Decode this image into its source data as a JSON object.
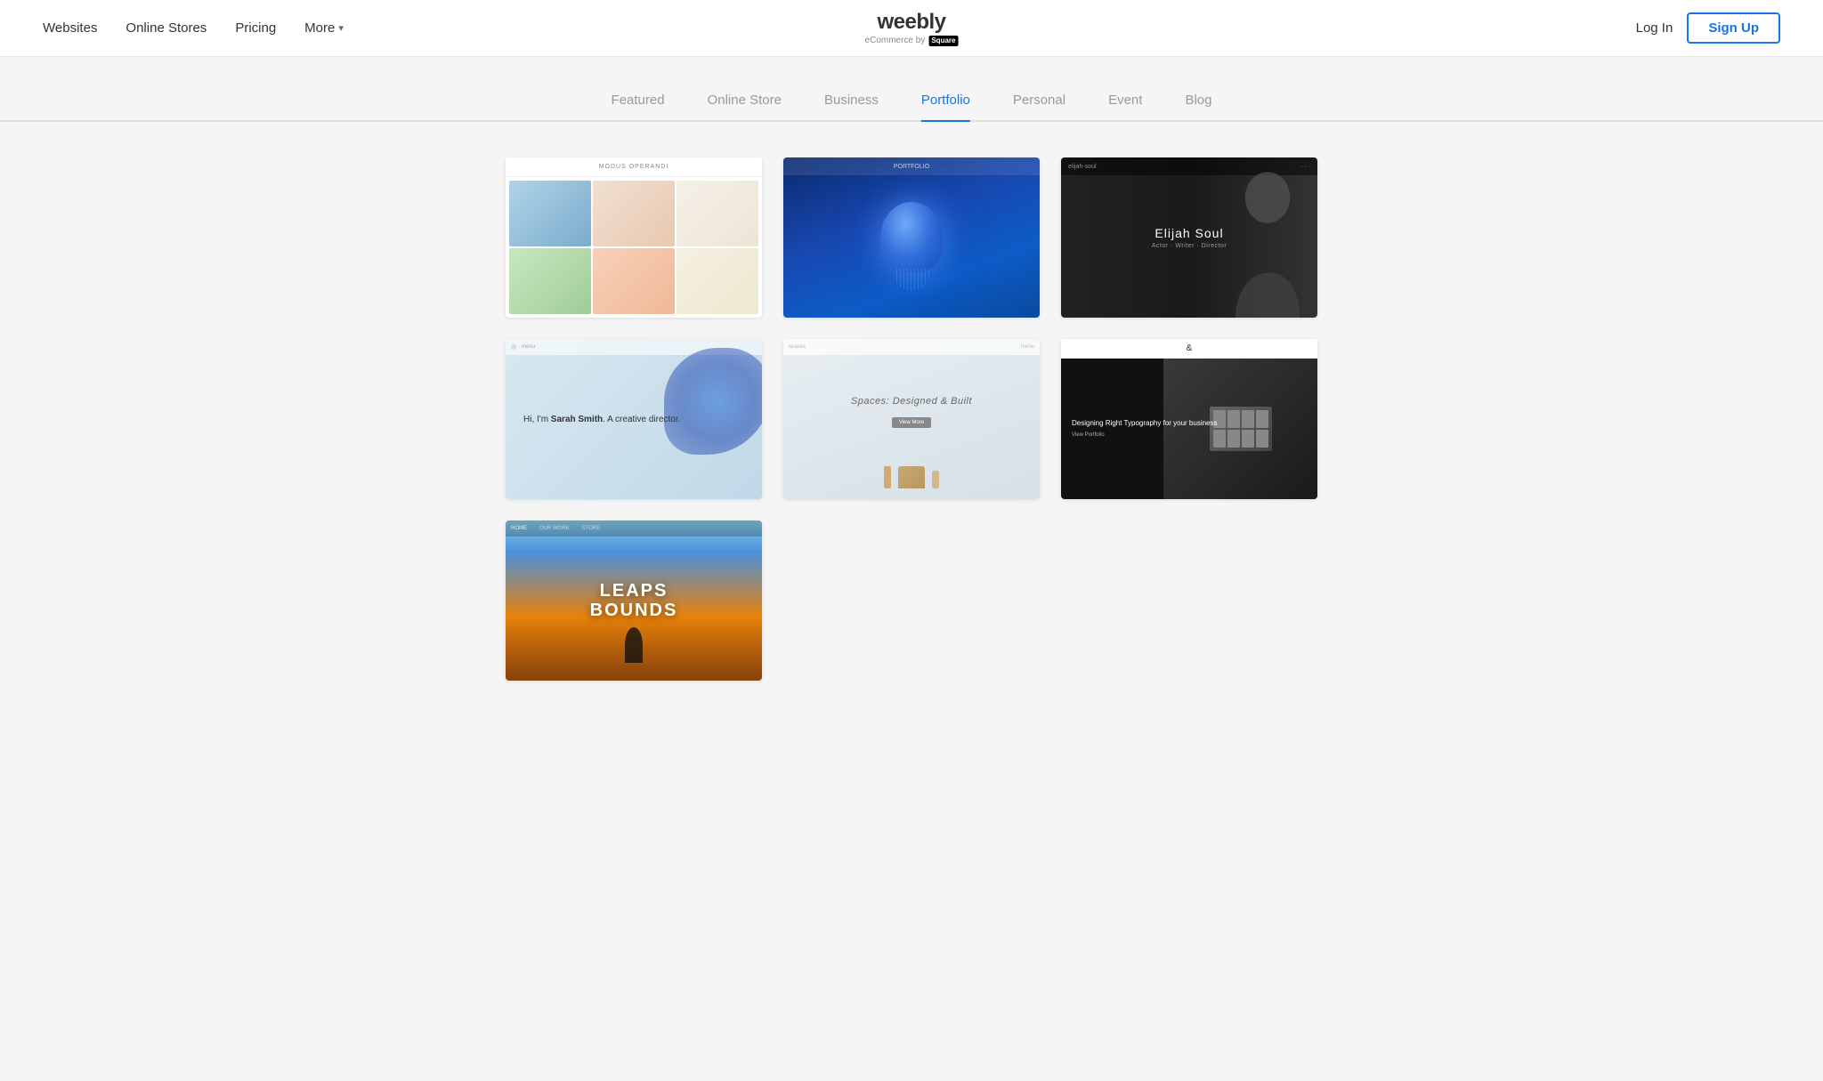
{
  "navbar": {
    "logo": "weebly",
    "logo_sub": "eCommerce by",
    "square_text": "Square",
    "nav_items": [
      {
        "id": "websites",
        "label": "Websites"
      },
      {
        "id": "online-stores",
        "label": "Online Stores"
      },
      {
        "id": "pricing",
        "label": "Pricing"
      },
      {
        "id": "more",
        "label": "More"
      }
    ],
    "more_chevron": "▾",
    "login_label": "Log In",
    "signup_label": "Sign Up"
  },
  "tabs": [
    {
      "id": "featured",
      "label": "Featured",
      "active": false
    },
    {
      "id": "online-store",
      "label": "Online Store",
      "active": false
    },
    {
      "id": "business",
      "label": "Business",
      "active": false
    },
    {
      "id": "portfolio",
      "label": "Portfolio",
      "active": true
    },
    {
      "id": "personal",
      "label": "Personal",
      "active": false
    },
    {
      "id": "event",
      "label": "Event",
      "active": false
    },
    {
      "id": "blog",
      "label": "Blog",
      "active": false
    }
  ],
  "templates": [
    {
      "id": "modus-operandi",
      "title": "MODUS OPERANDI",
      "type": "photo-grid"
    },
    {
      "id": "portfolio-jellyfish",
      "title": "PORTFOLIO",
      "type": "jellyfish"
    },
    {
      "id": "elijah-soul",
      "name": "Elijah Soul",
      "subtitle": "Actor · Writer · Director",
      "type": "portrait"
    },
    {
      "id": "sarah-smith",
      "text_before": "Hi, I'm ",
      "name": "Sarah Smith",
      "text_after": ". A creative director.",
      "type": "creative"
    },
    {
      "id": "spaces",
      "title": "Spaces: Designed & Built",
      "button_label": "View More",
      "type": "interior"
    },
    {
      "id": "typography",
      "ampersand": "&",
      "heading": "Designing Right Typography for your business",
      "link_label": "View Portfolio",
      "type": "typo"
    },
    {
      "id": "leaps-bounds",
      "line1": "LEAPS",
      "line2": "BOUNDS",
      "type": "sunset"
    }
  ]
}
